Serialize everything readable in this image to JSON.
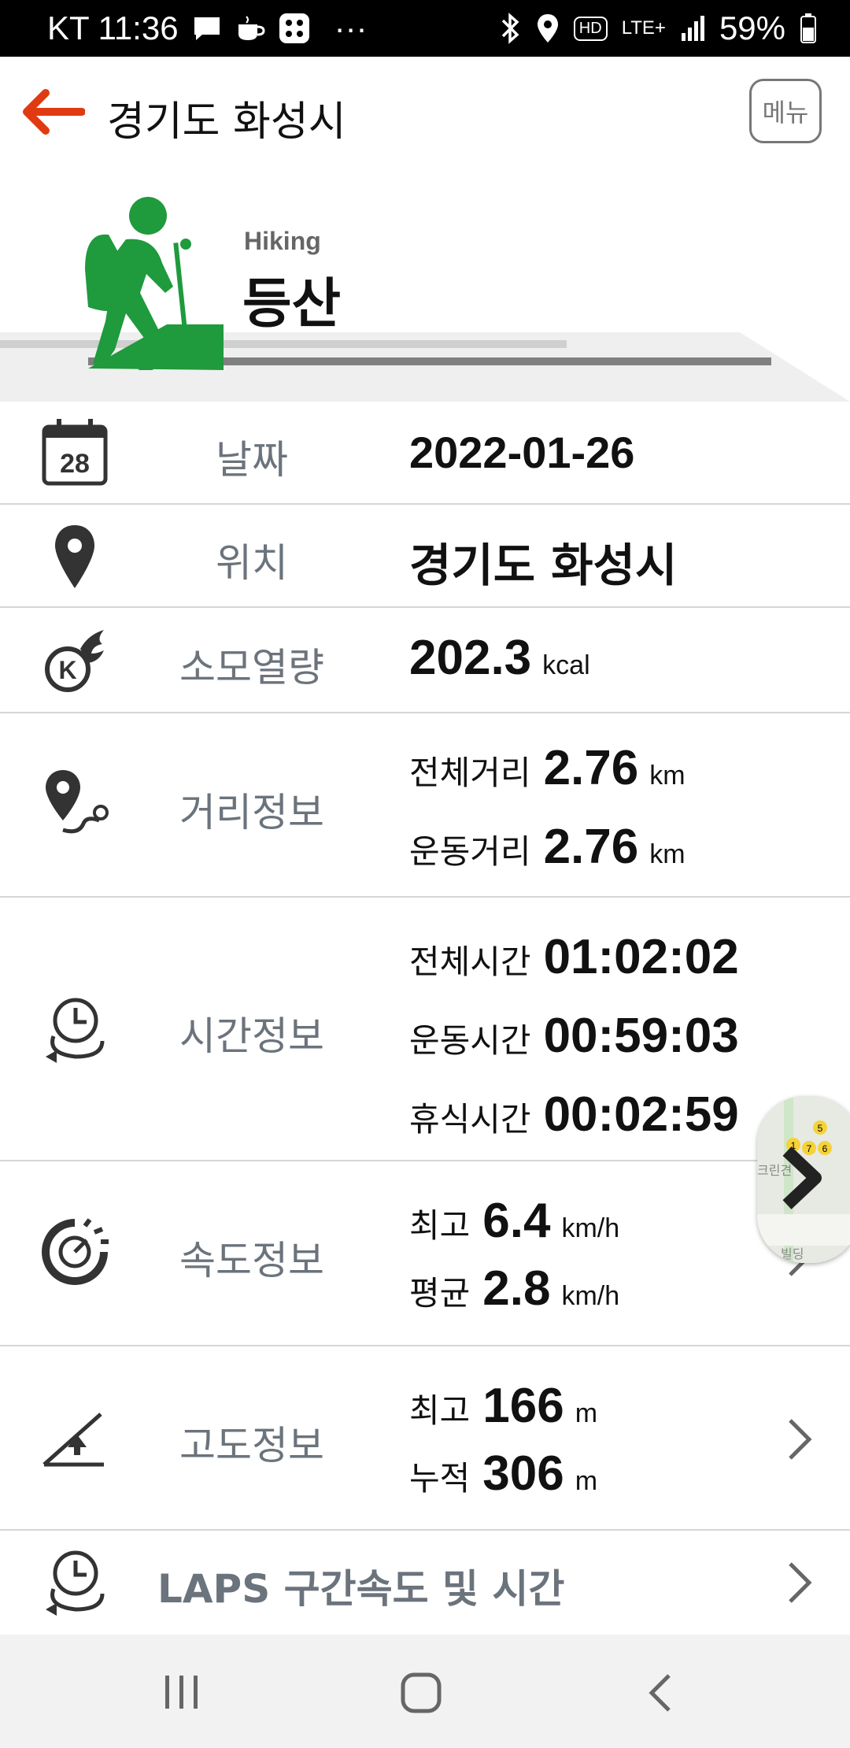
{
  "status_bar": {
    "carrier_time": "KT 11:36",
    "more": "···",
    "hd": "HD",
    "lte": "LTE+",
    "battery": "59%"
  },
  "header": {
    "title": "경기도 화성시",
    "menu_label": "메뉴"
  },
  "hero": {
    "activity_en": "Hiking",
    "activity_ko": "등산"
  },
  "rows": {
    "date": {
      "label": "날짜",
      "value": "2022-01-26",
      "icon_day": "28"
    },
    "location": {
      "label": "위치",
      "value": "경기도 화성시"
    },
    "calories": {
      "label": "소모열량",
      "value": "202.3",
      "unit": "kcal"
    },
    "distance": {
      "label": "거리정보",
      "total_label": "전체거리",
      "total_value": "2.76",
      "total_unit": "km",
      "exercise_label": "운동거리",
      "exercise_value": "2.76",
      "exercise_unit": "km"
    },
    "time": {
      "label": "시간정보",
      "total_label": "전체시간",
      "total_value": "01:02:02",
      "exercise_label": "운동시간",
      "exercise_value": "00:59:03",
      "rest_label": "휴식시간",
      "rest_value": "00:02:59"
    },
    "speed": {
      "label": "속도정보",
      "max_label": "최고",
      "max_value": "6.4",
      "max_unit": "km/h",
      "avg_label": "평균",
      "avg_value": "2.8",
      "avg_unit": "km/h"
    },
    "altitude": {
      "label": "고도정보",
      "max_label": "최고",
      "max_value": "166",
      "max_unit": "m",
      "cum_label": "누적",
      "cum_value": "306",
      "cum_unit": "m"
    },
    "laps": {
      "label": "LAPS 구간속도 및 시간"
    }
  },
  "map_thumb": {
    "poi_numbers": [
      "5",
      "1",
      "7",
      "6"
    ],
    "text_a": "크린견",
    "text_b": "빌딩"
  },
  "colors": {
    "accent": "#e03a12",
    "hiking_green": "#1f9a3c",
    "label_gray": "#6b737c"
  }
}
